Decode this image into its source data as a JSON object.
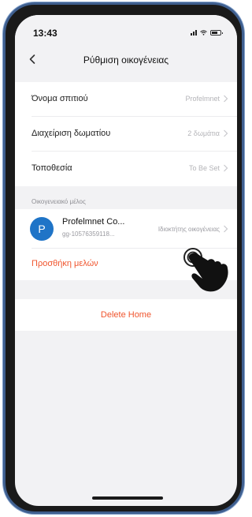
{
  "status_bar": {
    "time": "13:43"
  },
  "header": {
    "title": "Ρύθμιση οικογένειας"
  },
  "home_settings": [
    {
      "label": "Όνομα σπιτιού",
      "value": "Profelmnet"
    },
    {
      "label": "Διαχείριση δωματίου",
      "value": "2 δωμάτια"
    },
    {
      "label": "Τοποθεσία",
      "value": "To Be Set"
    }
  ],
  "members_section": {
    "label": "Οικογενειακό μέλος",
    "members": [
      {
        "avatar_letter": "P",
        "name": "Profelmnet Co...",
        "id": "gg-10576359118...",
        "role": "Ιδιοκτήτης οικογένειας"
      }
    ],
    "add_label": "Προσθήκη μελών"
  },
  "delete_label": "Delete Home",
  "colors": {
    "accent": "#f0552e",
    "avatar": "#1f74c7",
    "background": "#f2f2f4"
  },
  "icons": [
    "back-chevron-icon",
    "chevron-right-icon",
    "pointing-hand-icon",
    "signal-icon",
    "wifi-icon",
    "battery-icon"
  ]
}
